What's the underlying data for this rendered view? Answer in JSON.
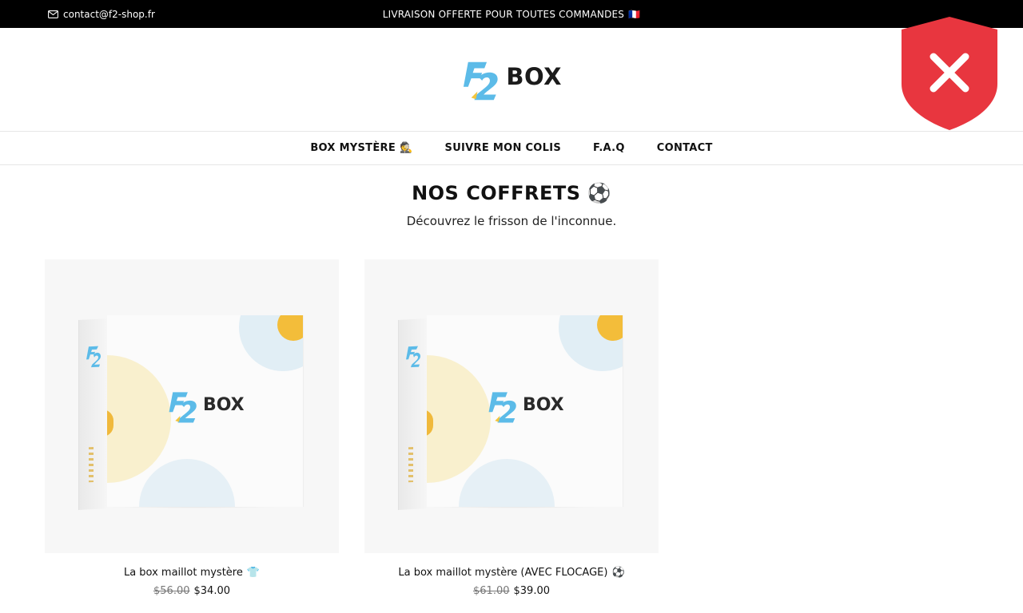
{
  "topbar": {
    "contact_email": "contact@f2-shop.fr",
    "announcement": "LIVRAISON OFFERTE POUR TOUTES COMMANDES",
    "announcement_flag": "🇫🇷"
  },
  "header": {
    "logo_text": "BOX",
    "logo_mark": "F2"
  },
  "nav": {
    "items": [
      {
        "label": "BOX MYSTÈRE",
        "emoji": "🕵️"
      },
      {
        "label": "SUIVRE MON COLIS"
      },
      {
        "label": "F.A.Q"
      },
      {
        "label": "CONTACT"
      }
    ]
  },
  "section": {
    "title": "NOS COFFRETS",
    "title_emoji": "⚽",
    "subtitle": "Découvrez le frisson de l'inconnue."
  },
  "products": [
    {
      "name": "La box maillot mystère",
      "emoji": "👕",
      "old_price": "$56.00",
      "price": "$34.00",
      "box_label": "BOX"
    },
    {
      "name": "La box maillot mystère (AVEC FLOCAGE)",
      "emoji": "⚽",
      "old_price": "$61.00",
      "price": "$39.00",
      "box_label": "BOX"
    }
  ],
  "overlay": {
    "icon": "shield-x-icon",
    "color": "#e8363f"
  },
  "colors": {
    "topbar_bg": "#000000",
    "accent_blue": "#4fb4e6",
    "accent_yellow": "#f3bd3a"
  }
}
